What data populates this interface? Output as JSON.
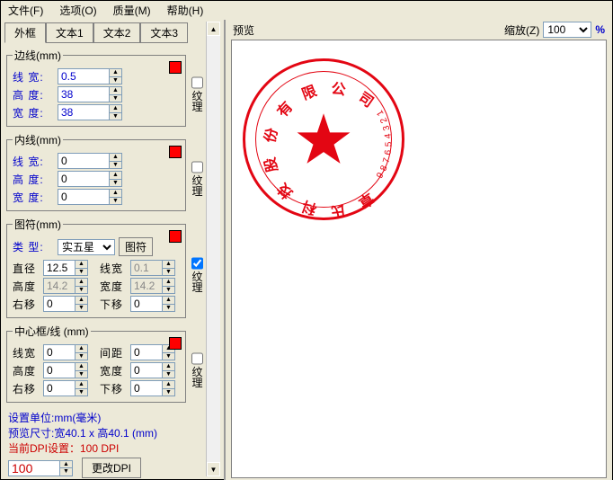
{
  "menu": {
    "file": "文件(F)",
    "options": "选项(O)",
    "quality": "质量(M)",
    "help": "帮助(H)"
  },
  "tabs": {
    "t1": "外框",
    "t2": "文本1",
    "t3": "文本2",
    "t4": "文本3"
  },
  "groups": {
    "border": {
      "title": "边线(mm)",
      "widthLabel": "线  宽:",
      "heightLabel": "高  度:",
      "breadthLabel": "宽  度:",
      "widthVal": "0.5",
      "heightVal": "38",
      "breadthVal": "38",
      "textureLabel": "纹理"
    },
    "inner": {
      "title": "内线(mm)",
      "widthLabel": "线  宽:",
      "heightLabel": "高  度:",
      "breadthLabel": "宽  度:",
      "widthVal": "0",
      "heightVal": "0",
      "breadthVal": "0",
      "textureLabel": "纹理"
    },
    "symbol": {
      "title": "图符(mm)",
      "typeLabel": "类  型:",
      "typeVal": "实五星",
      "symbolBtn": "图符",
      "diamLabel": "直径",
      "diamVal": "12.5",
      "lineWLabel": "线宽",
      "lineWVal": "0.1",
      "heightLabel": "高度",
      "heightVal": "14.2",
      "widthLabel": "宽度",
      "widthVal": "14.2",
      "rightLabel": "右移",
      "rightVal": "0",
      "downLabel": "下移",
      "downVal": "0",
      "textureLabel": "纹理"
    },
    "center": {
      "title": "中心框/线 (mm)",
      "lineWLabel": "线宽",
      "lineWVal": "0",
      "gapLabel": "间距",
      "gapVal": "0",
      "heightLabel": "高度",
      "heightVal": "0",
      "widthLabel": "宽度",
      "widthVal": "0",
      "rightLabel": "右移",
      "rightVal": "0",
      "downLabel": "下移",
      "downVal": "0",
      "textureLabel": "纹理"
    }
  },
  "footer": {
    "unit": "设置单位:mm(毫米)",
    "previewSize": "预览尺寸:宽40.1 x 高40.1 (mm)",
    "dpiInfo": "当前DPI设置：100 DPI",
    "dpiVal": "100",
    "dpiBtn": "更改DPI"
  },
  "preview": {
    "title": "预览",
    "zoomLabel": "缩放(Z)",
    "zoomVal": "100",
    "pct": "%"
  },
  "stamp": {
    "arcText": "章氏科技股份有限公司",
    "digits": "123456789"
  }
}
